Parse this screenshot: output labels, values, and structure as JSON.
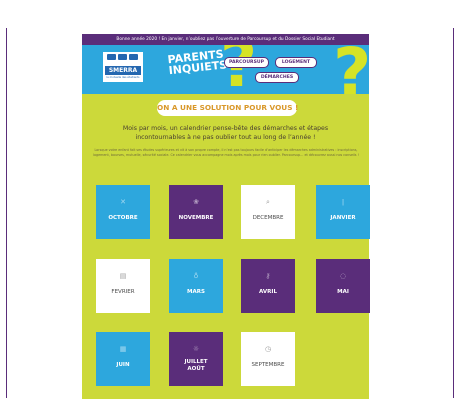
{
  "topbar": {
    "text": "Bonne année 2020 ! En janvier, n’oubliez pas l’ouverture de Parcoursup et du Dossier Social Etudiant"
  },
  "logo": {
    "brand": "SMERRA",
    "tagline": "la mutuelle des étudiants"
  },
  "header": {
    "title": "PARENTS INQUIETS",
    "qmark": "?"
  },
  "nav": [
    "PARCOURSUP",
    "LOGEMENT",
    "DÉMARCHES"
  ],
  "banner": "ON A UNE SOLUTION POUR VOUS !",
  "subtitle": "Mois par mois, un calendrier pense-bête des démarches et étapes incontournables à ne pas oublier tout au long de l’année !",
  "paragraph": "Lorsque votre enfant fait ses études supérieures et vit à son propre compte, il n’est pas toujours facile d’anticiper les démarches administratives : inscriptions, logement, bourses, mutuelle, sécurité sociale. Ce calendrier vous accompagne mois après mois pour rien oublier. Parcoursup… et découvrez aussi nos conseils !",
  "months": [
    {
      "label": "OCTOBRE",
      "color": "blue",
      "icon": "compass-icon",
      "glyph": "✕"
    },
    {
      "label": "NOVEMBRE",
      "color": "purple",
      "icon": "leaf-icon",
      "glyph": "❀"
    },
    {
      "label": "DECEMBRE",
      "color": "white",
      "icon": "search-icon",
      "glyph": "⌕"
    },
    {
      "label": "JANVIER",
      "color": "blue",
      "icon": "candle-icon",
      "glyph": "ǀ"
    },
    {
      "label": "FEVRIER",
      "color": "white",
      "icon": "document-icon",
      "glyph": "▤"
    },
    {
      "label": "MARS",
      "color": "blue",
      "icon": "location-icon",
      "glyph": "♁"
    },
    {
      "label": "AVRIL",
      "color": "purple",
      "icon": "key-icon",
      "glyph": "⚷"
    },
    {
      "label": "MAI",
      "color": "purple",
      "icon": "chat-icon",
      "glyph": "◌"
    },
    {
      "label": "JUIN",
      "color": "blue",
      "icon": "calendar-icon",
      "glyph": "▦"
    },
    {
      "label": "JUILLET AOÛT",
      "color": "purple",
      "icon": "sun-icon",
      "glyph": "☼"
    },
    {
      "label": "SEPTEMBRE",
      "color": "white",
      "icon": "clock-icon",
      "glyph": "◷"
    }
  ]
}
